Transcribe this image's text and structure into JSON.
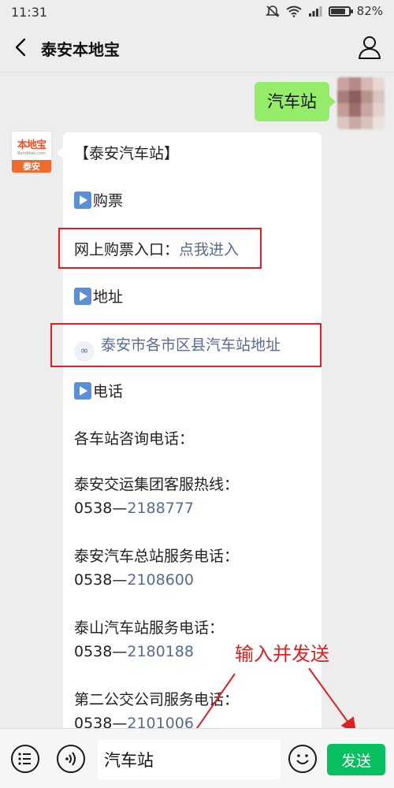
{
  "status_bar": {
    "time": "11:31",
    "battery": "82%",
    "battery_level": 0.82
  },
  "nav": {
    "title": "泰安本地宝"
  },
  "messages": {
    "sent": "汽车站",
    "bot_avatar": {
      "brand": "本地宝",
      "url": "Bendibao.com",
      "city": "泰安"
    },
    "bot": {
      "header": "【泰安汽车站】",
      "section_ticket": "购票",
      "ticket_prefix": "网上购票入口：",
      "ticket_link": "点我进入",
      "section_address": "地址",
      "address_link": "泰安市各市区县汽车站地址",
      "section_phone": "电话",
      "phone_intro": "各车站咨询电话：",
      "phones": [
        {
          "label": "泰安交运集团客服热线：",
          "prefix": "0538—",
          "number": "2188777"
        },
        {
          "label": "泰安汽车总站服务电话：",
          "prefix": "0538—",
          "number": "2108600"
        },
        {
          "label": "泰山汽车站服务电话：",
          "prefix": "0538—",
          "number": "2180188"
        },
        {
          "label": "第二公交公司服务电话：",
          "prefix": "0538—",
          "number": "2101006"
        }
      ]
    }
  },
  "annotation": {
    "text": "输入并发送",
    "color": "#e02020"
  },
  "input_bar": {
    "value": "汽车站",
    "send_label": "发送"
  },
  "colors": {
    "bubble_mine": "#95ec69",
    "link": "#576b95",
    "send": "#07c160",
    "highlight": "#e02020"
  },
  "icons": [
    "back-arrow-icon",
    "profile-icon",
    "play-icon",
    "link-icon",
    "menu-icon",
    "voice-icon",
    "emoji-icon"
  ]
}
